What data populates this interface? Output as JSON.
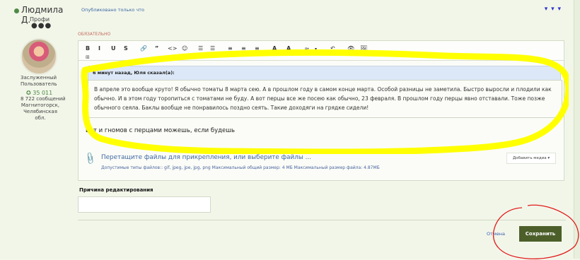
{
  "user": {
    "name": "Людмила Д.",
    "role": "Профи",
    "dots": "●●●",
    "status": "Заслуженный Пользователь",
    "score": "✪ 35 011",
    "messages": "8 722 сообщений",
    "location": "Магнитогорск, Челябинская обл."
  },
  "post": {
    "posted": "Опубликовано только что",
    "menu": "▾ ▾ ▾",
    "required": "ОБЯЗАТЕЛЬНО"
  },
  "toolbar": {
    "items": [
      "B",
      "I",
      "U",
      "S",
      "🔗",
      "”",
      "<>",
      "☺",
      "☰",
      "☰",
      "≡",
      "≡",
      "≡",
      "A",
      "A",
      "Pt",
      "▾",
      "↶",
      "👁",
      "🖼"
    ]
  },
  "editor": {
    "quote_header": "6 минут назад, Юля сказал(а):",
    "quote_text": "В апреле это вообще круто! Я обычно томаты 8 марта сею. А в прошлом году в самом конце марта. Особой разницы не заметила. Быстро выросли и плодили как обычно. И в этом году торопиться с томатами не буду. А вот перцы все же посею как обычно, 23 февраля. В прошлом году перцы явно отставали. Тоже позже обычного сеяла. Баклы вообще не понравилось поздно сеять. Такие доходяги на грядке сидели!",
    "reply_text": "Вот и гномов с перцами можешь, если будешь"
  },
  "attachments": {
    "drop_text": "Перетащите файлы для прикрепления, или выберите файлы ...",
    "meta": "Допустимые типы файлов:: gif, jpeg, jpe, jpg, png     Максимальный общий размер: 4 МБ     Максимальный размер файла: 4.87МБ",
    "media_button": "Добавить медиа ▾"
  },
  "edit_reason": {
    "label": "Причина редактирования",
    "value": ""
  },
  "actions": {
    "cancel": "Отмена",
    "save": "Сохранить"
  },
  "colors": {
    "accent": "#4c5f2a",
    "highlight": "#ffff00",
    "annotation": "#ff0000"
  }
}
